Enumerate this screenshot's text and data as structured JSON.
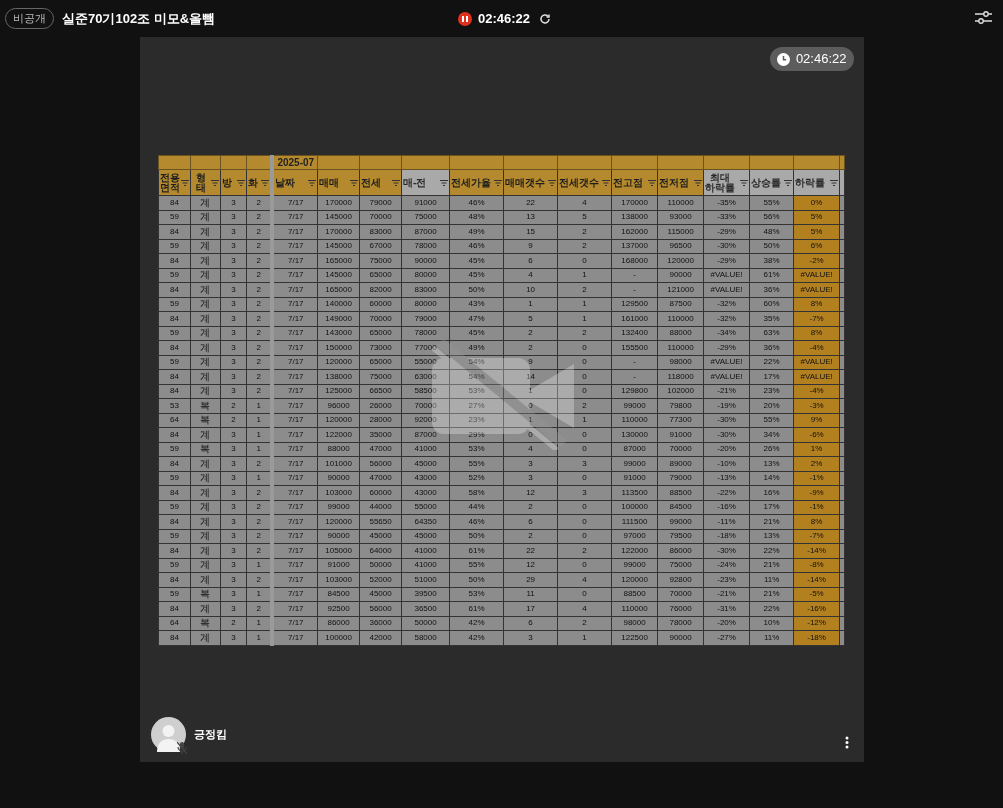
{
  "top_bar": {
    "visibility_badge": "비공개",
    "title": "실준70기102조 미모&올뺌",
    "recording": {
      "paused": true,
      "time": "02:46:22"
    }
  },
  "tile": {
    "timer": "02:46:22",
    "sheet": {
      "group_header": "2025-07",
      "columns": [
        {
          "label": "전용\n면적",
          "header_highlighted": true,
          "highlighted": false,
          "group_start": false
        },
        {
          "label": "형태",
          "header_highlighted": true,
          "highlighted": false,
          "group_start": false
        },
        {
          "label": "방",
          "header_highlighted": true,
          "highlighted": false,
          "group_start": false
        },
        {
          "label": "화",
          "header_highlighted": true,
          "highlighted": false,
          "group_start": false
        },
        {
          "label": "날짜",
          "header_highlighted": true,
          "highlighted": false,
          "group_start": true
        },
        {
          "label": "매매",
          "header_highlighted": true,
          "highlighted": false,
          "group_start": false
        },
        {
          "label": "전세",
          "header_highlighted": true,
          "highlighted": false,
          "group_start": false
        },
        {
          "label": "매-전",
          "header_highlighted": false,
          "highlighted": false,
          "group_start": false
        },
        {
          "label": "전세가율",
          "header_highlighted": true,
          "highlighted": false,
          "group_start": false
        },
        {
          "label": "매매갯수",
          "header_highlighted": true,
          "highlighted": false,
          "group_start": false
        },
        {
          "label": "전세갯수",
          "header_highlighted": true,
          "highlighted": false,
          "group_start": false
        },
        {
          "label": "전고점",
          "header_highlighted": true,
          "highlighted": false,
          "group_start": false
        },
        {
          "label": "전저점",
          "header_highlighted": true,
          "highlighted": false,
          "group_start": false
        },
        {
          "label": "최대\n하락률",
          "header_highlighted": false,
          "highlighted": false,
          "group_start": false
        },
        {
          "label": "상승률",
          "header_highlighted": false,
          "highlighted": false,
          "group_start": false
        },
        {
          "label": "하락률",
          "header_highlighted": false,
          "highlighted": true,
          "group_start": false
        }
      ],
      "rows": [
        [
          "84",
          "계",
          "3",
          "2",
          "7/17",
          "170000",
          "79000",
          "91000",
          "46%",
          "22",
          "4",
          "170000",
          "110000",
          "-35%",
          "55%",
          "0%"
        ],
        [
          "59",
          "계",
          "3",
          "2",
          "7/17",
          "145000",
          "70000",
          "75000",
          "48%",
          "13",
          "5",
          "138000",
          "93000",
          "-33%",
          "56%",
          "5%"
        ],
        [
          "84",
          "계",
          "3",
          "2",
          "7/17",
          "170000",
          "83000",
          "87000",
          "49%",
          "15",
          "2",
          "162000",
          "115000",
          "-29%",
          "48%",
          "5%"
        ],
        [
          "59",
          "계",
          "3",
          "2",
          "7/17",
          "145000",
          "67000",
          "78000",
          "46%",
          "9",
          "2",
          "137000",
          "96500",
          "-30%",
          "50%",
          "6%"
        ],
        [
          "84",
          "계",
          "3",
          "2",
          "7/17",
          "165000",
          "75000",
          "90000",
          "45%",
          "6",
          "0",
          "168000",
          "120000",
          "-29%",
          "38%",
          "-2%"
        ],
        [
          "59",
          "계",
          "3",
          "2",
          "7/17",
          "145000",
          "65000",
          "80000",
          "45%",
          "4",
          "1",
          "-",
          "90000",
          "#VALUE!",
          "61%",
          "#VALUE!"
        ],
        [
          "84",
          "계",
          "3",
          "2",
          "7/17",
          "165000",
          "82000",
          "83000",
          "50%",
          "10",
          "2",
          "-",
          "121000",
          "#VALUE!",
          "36%",
          "#VALUE!"
        ],
        [
          "59",
          "계",
          "3",
          "2",
          "7/17",
          "140000",
          "60000",
          "80000",
          "43%",
          "1",
          "1",
          "129500",
          "87500",
          "-32%",
          "60%",
          "8%"
        ],
        [
          "84",
          "계",
          "3",
          "2",
          "7/17",
          "149000",
          "70000",
          "79000",
          "47%",
          "5",
          "1",
          "161000",
          "110000",
          "-32%",
          "35%",
          "-7%"
        ],
        [
          "59",
          "계",
          "3",
          "2",
          "7/17",
          "143000",
          "65000",
          "78000",
          "45%",
          "2",
          "2",
          "132400",
          "88000",
          "-34%",
          "63%",
          "8%"
        ],
        [
          "84",
          "계",
          "3",
          "2",
          "7/17",
          "150000",
          "73000",
          "77000",
          "49%",
          "2",
          "0",
          "155500",
          "110000",
          "-29%",
          "36%",
          "-4%"
        ],
        [
          "59",
          "계",
          "3",
          "2",
          "7/17",
          "120000",
          "65000",
          "55000",
          "54%",
          "9",
          "0",
          "-",
          "98000",
          "#VALUE!",
          "22%",
          "#VALUE!"
        ],
        [
          "84",
          "계",
          "3",
          "2",
          "7/17",
          "138000",
          "75000",
          "63000",
          "54%",
          "14",
          "0",
          "-",
          "118000",
          "#VALUE!",
          "17%",
          "#VALUE!"
        ],
        [
          "84",
          "계",
          "3",
          "2",
          "7/17",
          "125000",
          "66500",
          "58500",
          "53%",
          "1",
          "0",
          "129800",
          "102000",
          "-21%",
          "23%",
          "-4%"
        ],
        [
          "53",
          "복",
          "2",
          "1",
          "7/17",
          "96000",
          "26000",
          "70000",
          "27%",
          "0",
          "2",
          "99000",
          "79800",
          "-19%",
          "20%",
          "-3%"
        ],
        [
          "64",
          "복",
          "2",
          "1",
          "7/17",
          "120000",
          "28000",
          "92000",
          "23%",
          "1",
          "1",
          "110000",
          "77300",
          "-30%",
          "55%",
          "9%"
        ],
        [
          "84",
          "계",
          "3",
          "1",
          "7/17",
          "122000",
          "35000",
          "87000",
          "29%",
          "0",
          "0",
          "130000",
          "91000",
          "-30%",
          "34%",
          "-6%"
        ],
        [
          "59",
          "복",
          "3",
          "1",
          "7/17",
          "88000",
          "47000",
          "41000",
          "53%",
          "4",
          "0",
          "87000",
          "70000",
          "-20%",
          "26%",
          "1%"
        ],
        [
          "84",
          "계",
          "3",
          "2",
          "7/17",
          "101000",
          "56000",
          "45000",
          "55%",
          "3",
          "3",
          "99000",
          "89000",
          "-10%",
          "13%",
          "2%"
        ],
        [
          "59",
          "계",
          "3",
          "1",
          "7/17",
          "90000",
          "47000",
          "43000",
          "52%",
          "3",
          "0",
          "91000",
          "79000",
          "-13%",
          "14%",
          "-1%"
        ],
        [
          "84",
          "계",
          "3",
          "2",
          "7/17",
          "103000",
          "60000",
          "43000",
          "58%",
          "12",
          "3",
          "113500",
          "88500",
          "-22%",
          "16%",
          "-9%"
        ],
        [
          "59",
          "계",
          "3",
          "2",
          "7/17",
          "99000",
          "44000",
          "55000",
          "44%",
          "2",
          "0",
          "100000",
          "84500",
          "-16%",
          "17%",
          "-1%"
        ],
        [
          "84",
          "계",
          "3",
          "2",
          "7/17",
          "120000",
          "55650",
          "64350",
          "46%",
          "6",
          "0",
          "111500",
          "99000",
          "-11%",
          "21%",
          "8%"
        ],
        [
          "59",
          "계",
          "3",
          "2",
          "7/17",
          "90000",
          "45000",
          "45000",
          "50%",
          "2",
          "0",
          "97000",
          "79500",
          "-18%",
          "13%",
          "-7%"
        ],
        [
          "84",
          "계",
          "3",
          "2",
          "7/17",
          "105000",
          "64000",
          "41000",
          "61%",
          "22",
          "2",
          "122000",
          "86000",
          "-30%",
          "22%",
          "-14%"
        ],
        [
          "59",
          "계",
          "3",
          "1",
          "7/17",
          "91000",
          "50000",
          "41000",
          "55%",
          "12",
          "0",
          "99000",
          "75000",
          "-24%",
          "21%",
          "-8%"
        ],
        [
          "84",
          "계",
          "3",
          "2",
          "7/17",
          "103000",
          "52000",
          "51000",
          "50%",
          "29",
          "4",
          "120000",
          "92800",
          "-23%",
          "11%",
          "-14%"
        ],
        [
          "59",
          "복",
          "3",
          "1",
          "7/17",
          "84500",
          "45000",
          "39500",
          "53%",
          "11",
          "0",
          "88500",
          "70000",
          "-21%",
          "21%",
          "-5%"
        ],
        [
          "84",
          "계",
          "3",
          "2",
          "7/17",
          "92500",
          "56000",
          "36500",
          "61%",
          "17",
          "4",
          "110000",
          "76000",
          "-31%",
          "22%",
          "-16%"
        ],
        [
          "64",
          "복",
          "2",
          "1",
          "7/17",
          "86000",
          "36000",
          "50000",
          "42%",
          "6",
          "2",
          "98000",
          "78000",
          "-20%",
          "10%",
          "-12%"
        ],
        [
          "84",
          "계",
          "3",
          "1",
          "7/17",
          "100000",
          "42000",
          "58000",
          "42%",
          "3",
          "1",
          "122500",
          "90000",
          "-27%",
          "11%",
          "-18%"
        ]
      ]
    },
    "camera_off": true,
    "participant": {
      "name": "긍정킴",
      "mic_muted": true
    }
  }
}
